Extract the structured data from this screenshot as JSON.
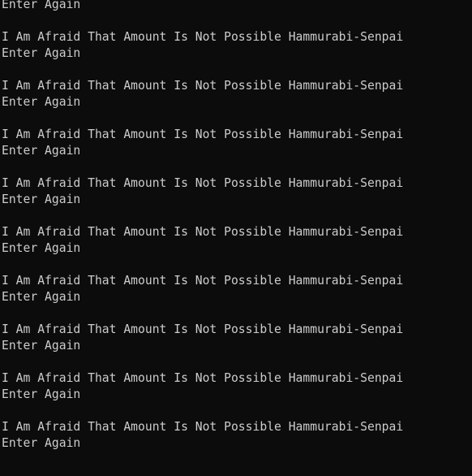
{
  "console": {
    "background": "#0c0c0c",
    "foreground": "#cccccc",
    "lines": [
      "Enter Again",
      "",
      "I Am Afraid That Amount Is Not Possible Hammurabi-Senpai",
      "Enter Again",
      "",
      "I Am Afraid That Amount Is Not Possible Hammurabi-Senpai",
      "Enter Again",
      "",
      "I Am Afraid That Amount Is Not Possible Hammurabi-Senpai",
      "Enter Again",
      "",
      "I Am Afraid That Amount Is Not Possible Hammurabi-Senpai",
      "Enter Again",
      "",
      "I Am Afraid That Amount Is Not Possible Hammurabi-Senpai",
      "Enter Again",
      "",
      "I Am Afraid That Amount Is Not Possible Hammurabi-Senpai",
      "Enter Again",
      "",
      "I Am Afraid That Amount Is Not Possible Hammurabi-Senpai",
      "Enter Again",
      "",
      "I Am Afraid That Amount Is Not Possible Hammurabi-Senpai",
      "Enter Again",
      "",
      "I Am Afraid That Amount Is Not Possible Hammurabi-Senpai",
      "Enter Again"
    ]
  }
}
